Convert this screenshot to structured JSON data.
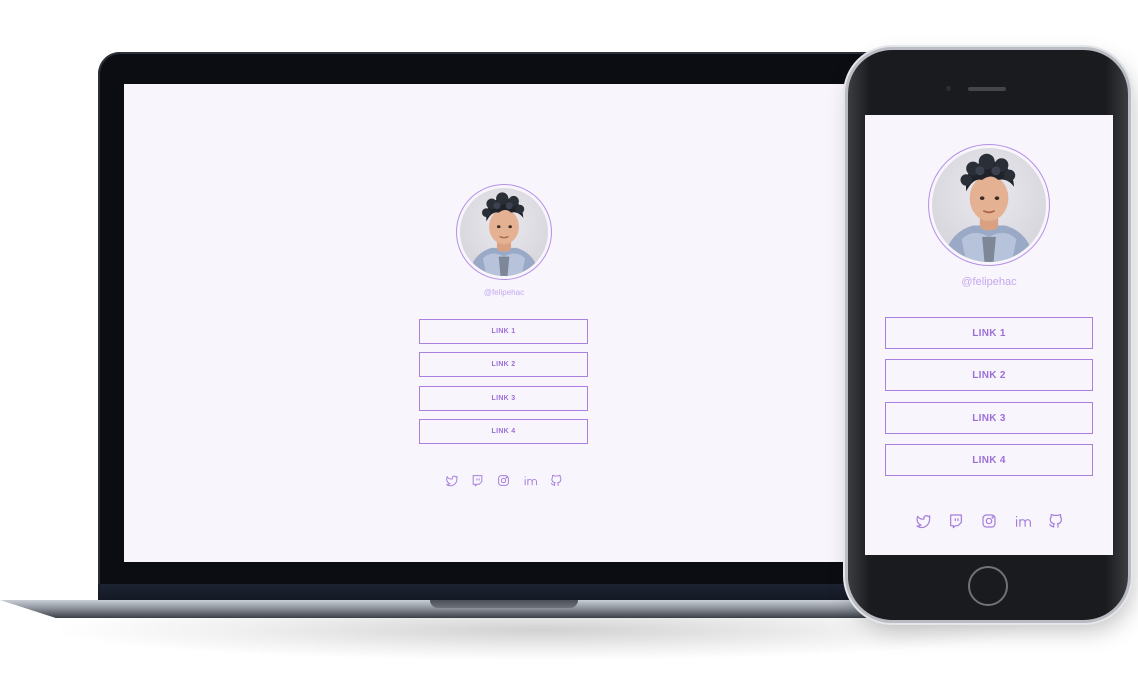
{
  "profile": {
    "handle": "@felipehac",
    "avatar": "3d-avatar-boy-curly-hair-hoodie"
  },
  "links": [
    {
      "label": "LINK 1"
    },
    {
      "label": "LINK 2"
    },
    {
      "label": "LINK 3"
    },
    {
      "label": "LINK 4"
    }
  ],
  "socials": [
    {
      "icon": "twitter-icon"
    },
    {
      "icon": "twitch-icon"
    },
    {
      "icon": "instagram-icon"
    },
    {
      "icon": "linkedin-icon"
    },
    {
      "icon": "github-icon"
    }
  ],
  "colors": {
    "page_background": "#f8f5fc",
    "accent": "#a97fe0",
    "handle_text": "#c4a9ef"
  }
}
